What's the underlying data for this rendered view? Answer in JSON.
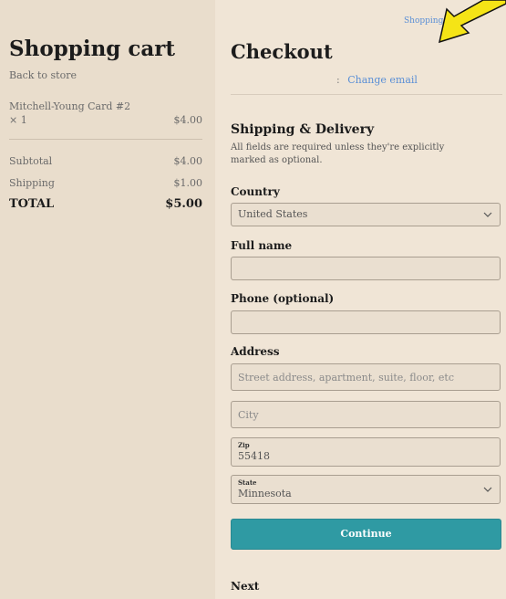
{
  "header": {
    "link": "Shopping"
  },
  "cart": {
    "title": "Shopping cart",
    "back_label": "Back to store",
    "item": {
      "name": "Mitchell-Young Card #2",
      "qty": "× 1",
      "price": "$4.00"
    },
    "subtotal_label": "Subtotal",
    "subtotal_value": "$4.00",
    "shipping_label": "Shipping",
    "shipping_value": "$1.00",
    "total_label": "TOTAL",
    "total_value": "$5.00"
  },
  "checkout": {
    "title": "Checkout",
    "email_separator": ":",
    "change_email": "Change email",
    "section_title": "Shipping & Delivery",
    "section_desc": "All fields are required unless they're explicitly marked as optional.",
    "country_label": "Country",
    "country_value": "United States",
    "fullname_label": "Full name",
    "phone_label": "Phone (optional)",
    "address_label": "Address",
    "street_placeholder": "Street address, apartment, suite, floor, etc",
    "city_placeholder": "City",
    "zip_label": "Zip",
    "zip_value": "55418",
    "state_label": "State",
    "state_value": "Minnesota",
    "continue_label": "Continue",
    "next_label": "Next"
  },
  "colors": {
    "background": "#f0e5d6",
    "cart_panel": "#e9ddcc",
    "accent": "#2f9aa3",
    "link": "#5a8fd6",
    "arrow": "#f5e416"
  },
  "icons": {
    "arrow": "yellow-arrow-icon",
    "chevron": "chevron-down-icon"
  }
}
